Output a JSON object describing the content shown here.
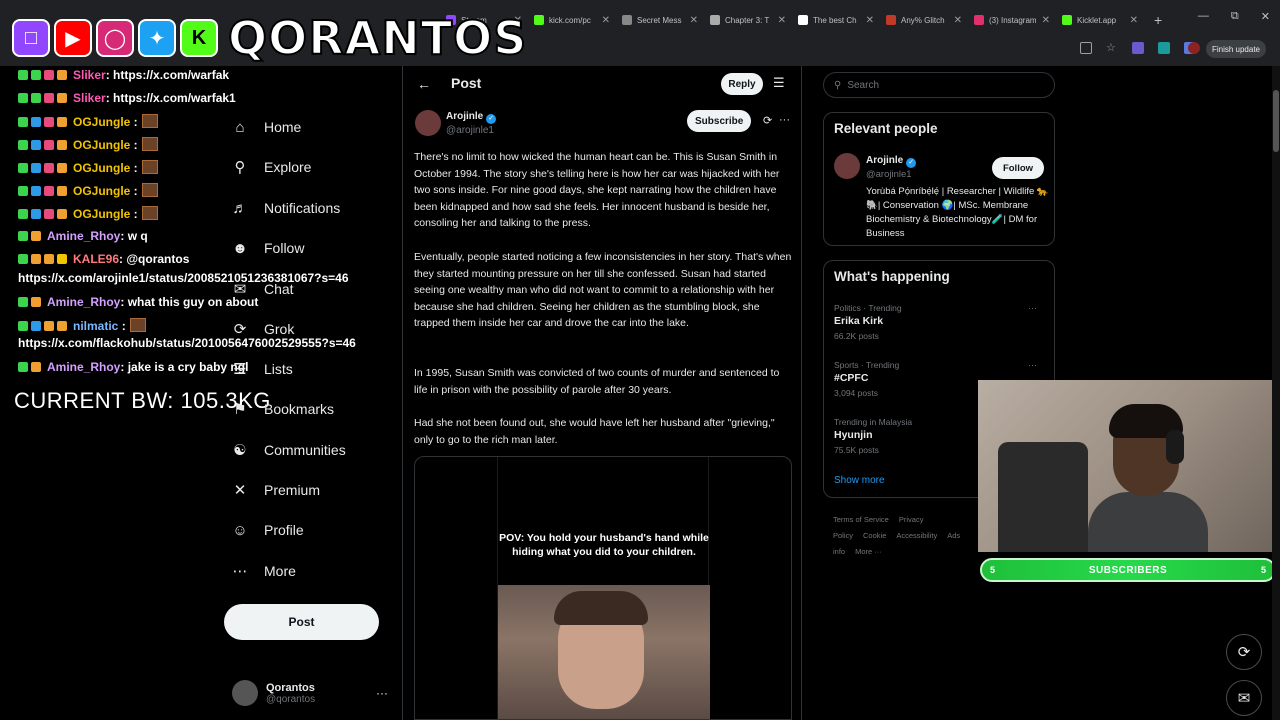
{
  "browser": {
    "tabs": [
      {
        "label": "Stream",
        "color": "#9146ff"
      },
      {
        "label": "kick.com/pc",
        "color": "#53fc18"
      },
      {
        "label": "Secret Mess",
        "color": "#888888"
      },
      {
        "label": "Chapter 3: T",
        "color": "#aaaaaa"
      },
      {
        "label": "The best Ch",
        "color": "#ffffff"
      },
      {
        "label": "Any% Glitch",
        "color": "#c0392b"
      },
      {
        "label": "(3) Instagram",
        "color": "#e1306c"
      },
      {
        "label": "Kicklet.app",
        "color": "#53fc18"
      }
    ],
    "finish_update": "Finish update"
  },
  "overlay": {
    "brand": "QORANTOS",
    "body_weight": "CURRENT BW: 105.3KG",
    "chat": [
      {
        "user": "Sliker",
        "msg": ": https://x.com/warfak",
        "color": "#ff5ab4",
        "badges": [
          "#3cd44c",
          "#3cd44c",
          "#e84a7b",
          "#f0a030"
        ]
      },
      {
        "user": "Sliker",
        "msg": ": https://x.com/warfak1",
        "color": "#ff5ab4",
        "badges": [
          "#3cd44c",
          "#3cd44c",
          "#e84a7b",
          "#f0a030"
        ]
      },
      {
        "user": "OGJungle",
        "msg": " :",
        "color": "#f2c400",
        "badges": [
          "#3cd44c",
          "#2e9ae6",
          "#e84a7b",
          "#f0a030"
        ]
      },
      {
        "user": "OGJungle",
        "msg": " :",
        "color": "#f2c400",
        "badges": [
          "#3cd44c",
          "#2e9ae6",
          "#e84a7b",
          "#f0a030"
        ]
      },
      {
        "user": "OGJungle",
        "msg": " :",
        "color": "#f2c400",
        "badges": [
          "#3cd44c",
          "#2e9ae6",
          "#e84a7b",
          "#f0a030"
        ]
      },
      {
        "user": "OGJungle",
        "msg": " :",
        "color": "#f2c400",
        "badges": [
          "#3cd44c",
          "#2e9ae6",
          "#e84a7b",
          "#f0a030"
        ]
      },
      {
        "user": "OGJungle",
        "msg": " :",
        "color": "#f2c400",
        "badges": [
          "#3cd44c",
          "#2e9ae6",
          "#e84a7b",
          "#f0a030"
        ]
      },
      {
        "user": "Amine_Rhoy",
        "msg": ": w q",
        "color": "#d2a0ff",
        "badges": [
          "#3cd44c",
          "#f0a030"
        ]
      },
      {
        "user": "KALE96",
        "msg": ": @qorantos",
        "color": "#ff7a7a",
        "badges": [
          "#3cd44c",
          "#f0a030",
          "#f0a030",
          "#f2c400"
        ]
      },
      {
        "user": "Amine_Rhoy",
        "msg": ": what this guy on about",
        "color": "#d2a0ff",
        "badges": [
          "#3cd44c",
          "#f0a030"
        ]
      },
      {
        "user": "nilmatic",
        "msg": " :",
        "color": "#7ab8ff",
        "badges": [
          "#3cd44c",
          "#2e9ae6",
          "#f0a030",
          "#f0a030"
        ]
      },
      {
        "user": "Amine_Rhoy",
        "msg": ": jake is a cry baby ngl",
        "color": "#d2a0ff",
        "badges": [
          "#3cd44c",
          "#f0a030"
        ]
      }
    ],
    "urls": [
      "https://x.com/arojinle1/status/2008521051236381067?s=46",
      "https://x.com/flackohub/status/2010056476002529555?s=46"
    ],
    "subscribers": {
      "label": "SUBSCRIBERS",
      "current": "5",
      "goal": "5"
    }
  },
  "nav": {
    "items": [
      "Home",
      "Explore",
      "Notifications",
      "Follow",
      "Chat",
      "Grok",
      "Lists",
      "Bookmarks",
      "Communities",
      "Premium",
      "Profile",
      "More"
    ],
    "post_button": "Post",
    "account_name": "Qorantos",
    "account_handle": "@qorantos"
  },
  "main": {
    "title": "Post",
    "reply_button": "Reply",
    "author": "Arojinle",
    "handle": "@arojinle1",
    "subscribe_button": "Subscribe",
    "paragraphs": [
      "There's no limit to how wicked the human heart can be. This is Susan Smith in October 1994. The story she's telling here is how her car was hijacked with her two sons inside. For nine good days, she kept narrating how the children have been kidnapped and how sad she feels. Her innocent husband is beside her, consoling her and talking to the press.",
      "Eventually, people started noticing a few inconsistencies in her story. That's when they started mounting pressure on her till she confessed. Susan had started seeing one wealthy man who did not want to commit to a relationship with her because she had children. Seeing her children as the stumbling block, she trapped them inside her car and drove the car into the lake.",
      "In 1995, Susan Smith was convicted of two counts of murder and sentenced to life in prison with the possibility of parole after 30 years.",
      "Had she not been found out, she would have left her husband after \"grieving,\" only to go to the rich man later."
    ],
    "media_caption": "POV: You hold your husband's hand while hiding what you did to your children."
  },
  "right": {
    "search_placeholder": "Search",
    "relevant_title": "Relevant people",
    "relevant": {
      "name": "Arojinle",
      "handle": "@arojinle1",
      "follow_button": "Follow",
      "bio": "Yorùbá Pọ́nríbẹ́lẹ́ | Researcher | Wildlife 🐆🐘| Conservation 🌍| MSc. Membrane Biochemistry & Biotechnology🧪| DM for Business"
    },
    "happening_title": "What's happening",
    "trends": [
      {
        "meta": "Politics · Trending",
        "name": "Erika Kirk",
        "count": "66.2K posts"
      },
      {
        "meta": "Sports · Trending",
        "name": "#CPFC",
        "count": "3,094 posts"
      },
      {
        "meta": "Trending in Malaysia",
        "name": "Hyunjin",
        "count": "75.5K posts"
      }
    ],
    "show_more": "Show more",
    "footer": [
      "Terms of Service",
      "Privacy Policy",
      "Cookie",
      "Accessibility",
      "Ads info",
      "More ···"
    ]
  }
}
